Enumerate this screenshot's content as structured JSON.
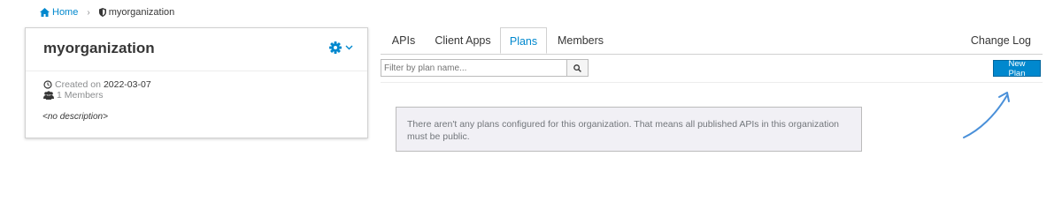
{
  "breadcrumb": {
    "home": "Home",
    "separator": "›",
    "current": "myorganization"
  },
  "org": {
    "title": "myorganization",
    "created_prefix": "Created on",
    "created_date": "2022-03-07",
    "members": "1 Members",
    "description": "<no description>"
  },
  "tabs": [
    "APIs",
    "Client Apps",
    "Plans",
    "Members"
  ],
  "active_tab": "Plans",
  "change_log": "Change Log",
  "filter": {
    "placeholder": "Filter by plan name..."
  },
  "new_plan_label": "New Plan",
  "empty_message": "There aren't any plans configured for this organization. That means all published APIs in this organization must be public.",
  "colors": {
    "accent": "#0088ce",
    "muted": "#8b8d8f",
    "text": "#363636",
    "arrow": "#4a90d9",
    "empty_bg": "#f1f0f5"
  },
  "icons": [
    "home-icon",
    "shield-icon",
    "gear-icon",
    "chevron-down-icon",
    "clock-icon",
    "users-icon",
    "search-icon",
    "arrow-annotation"
  ]
}
